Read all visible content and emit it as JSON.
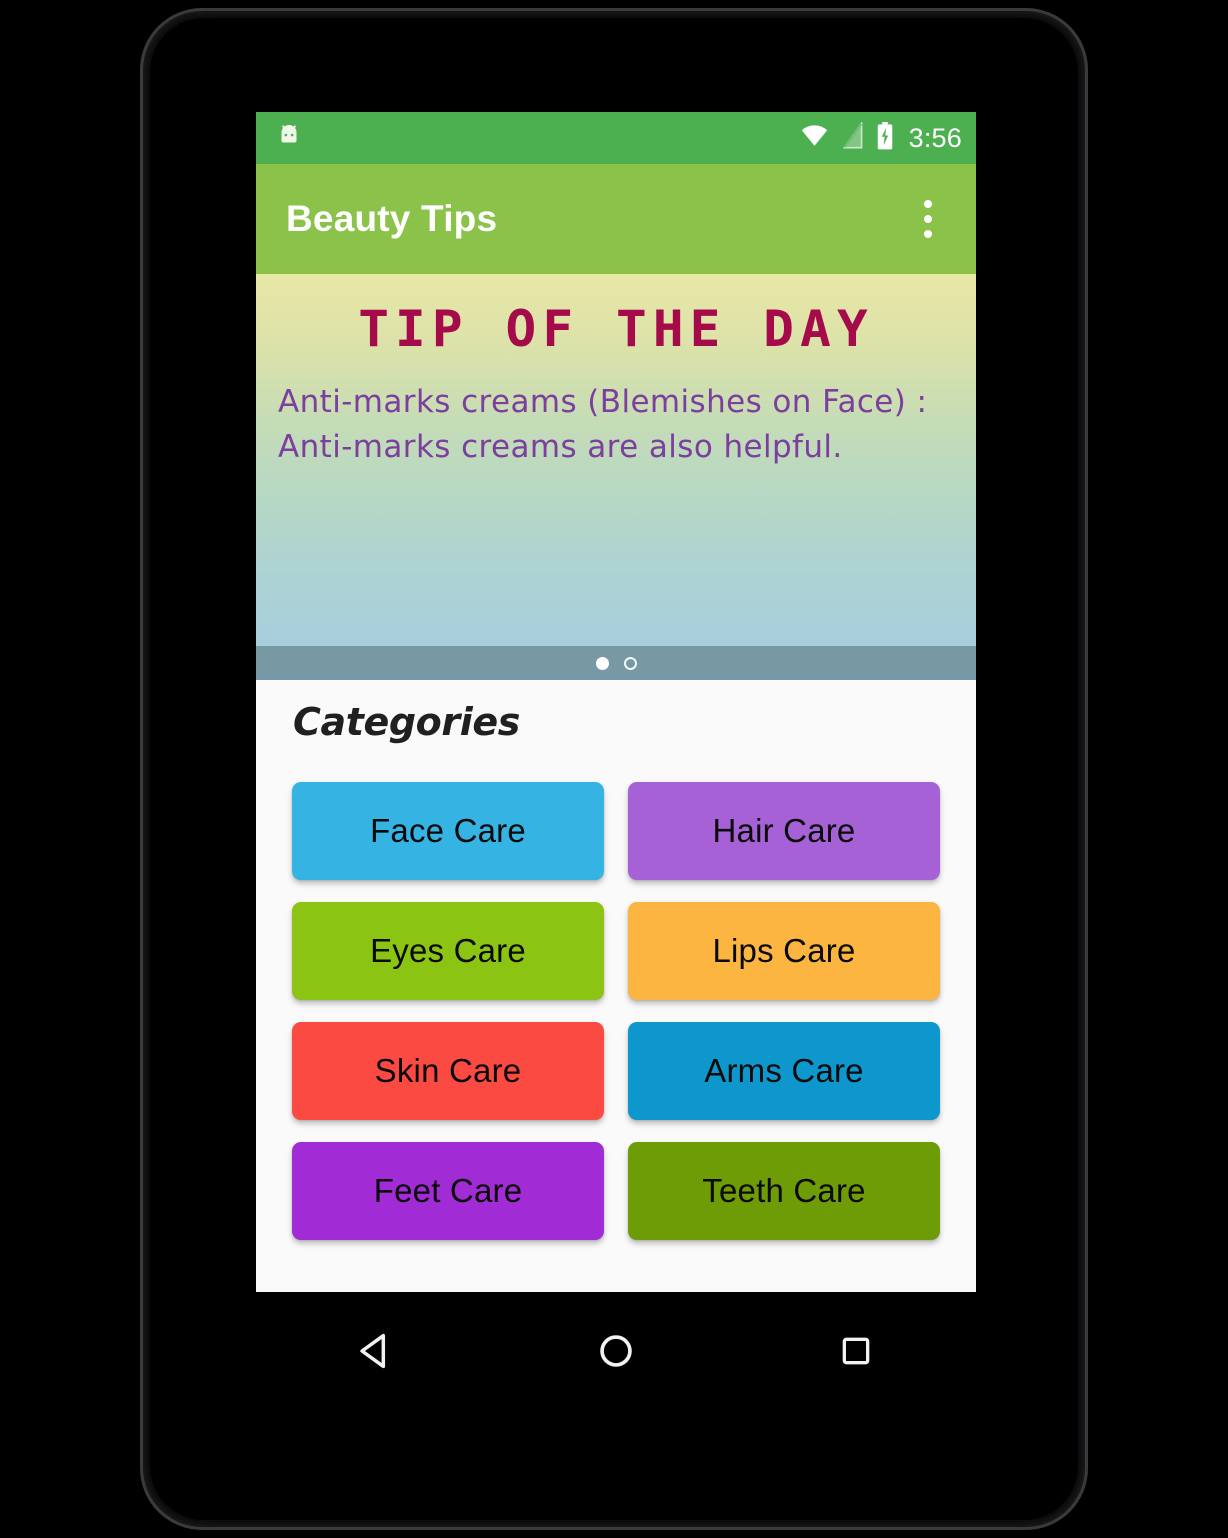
{
  "status_bar": {
    "app_icon": "android-mascot-icon",
    "icons": [
      "wifi-icon",
      "no-sim-icon",
      "battery-charging-icon"
    ],
    "time": "3:56",
    "background_color": "#4CAF50"
  },
  "app_bar": {
    "title": "Beauty Tips",
    "overflow_label": "overflow-menu",
    "background_color": "#8BC34A",
    "title_color": "#FFFFFF"
  },
  "tip_banner": {
    "title": "TIP OF THE DAY",
    "text": "Anti-marks creams (Blemishes on Face) : Anti-marks creams are also helpful.",
    "title_color": "#A50B4A",
    "text_color": "#7C3F9E",
    "gradient_top": "#E9E7A6",
    "gradient_bottom": "#A6CDDE",
    "page_indicators": [
      {
        "state": "active"
      },
      {
        "state": "inactive"
      }
    ]
  },
  "categories": {
    "heading": "Categories",
    "background_color": "#FAFAFA",
    "items": [
      {
        "label": "Face Care",
        "color": "#35B3E3"
      },
      {
        "label": "Hair Care",
        "color": "#A761D6"
      },
      {
        "label": "Eyes Care",
        "color": "#8CC413"
      },
      {
        "label": "Lips Care",
        "color": "#FBB540"
      },
      {
        "label": "Skin Care",
        "color": "#FB4A42"
      },
      {
        "label": "Arms Care",
        "color": "#0D97CC"
      },
      {
        "label": "Feet Care",
        "color": "#A12BD4"
      },
      {
        "label": "Teeth Care",
        "color": "#6E9C06"
      }
    ]
  },
  "nav_bar": {
    "buttons": [
      {
        "name": "back-button",
        "icon": "triangle-back-icon"
      },
      {
        "name": "home-button",
        "icon": "circle-home-icon"
      },
      {
        "name": "recents-button",
        "icon": "square-recents-icon"
      }
    ],
    "background_color": "#000000"
  }
}
